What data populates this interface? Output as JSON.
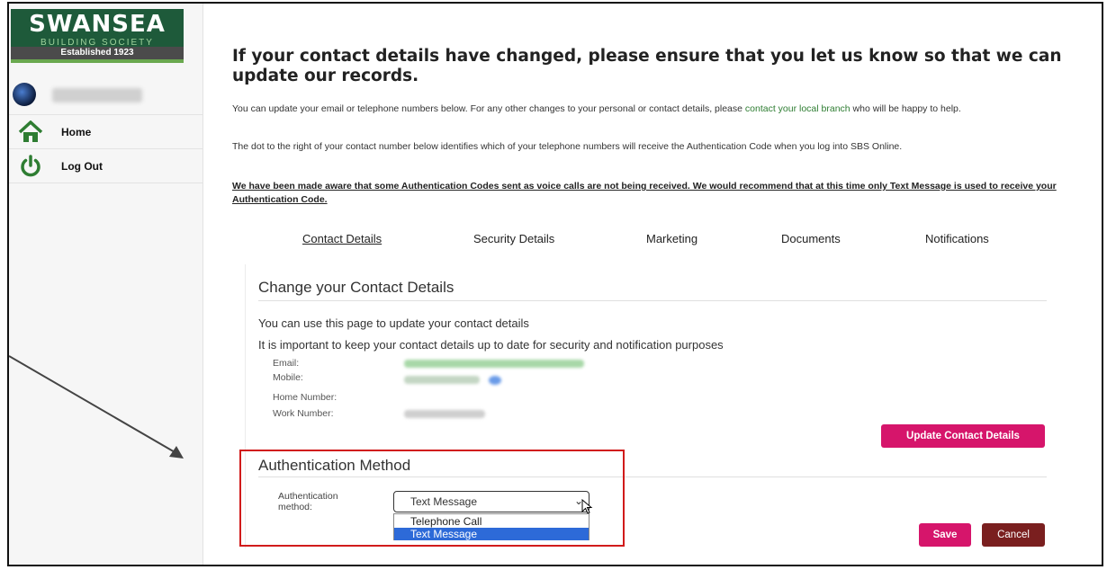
{
  "brand": {
    "name": "SWANSEA",
    "subtitle": "BUILDING SOCIETY",
    "established": "Established 1923",
    "colors": {
      "green": "#1e5a3a",
      "pink": "#d6156b",
      "maroon": "#7a1f1f"
    }
  },
  "sidebar": {
    "items": [
      {
        "label": "Home",
        "icon": "home-icon"
      },
      {
        "label": "Log Out",
        "icon": "power-icon"
      }
    ]
  },
  "main": {
    "heading": "If your contact details have changed, please ensure that you let us know so that we can update our records.",
    "intro_before_link": "You can update your email or telephone numbers below. For any other changes to your personal or contact details, please ",
    "intro_link": "contact your local branch",
    "intro_after_link": " who will be happy to help.",
    "dot_info": "The dot to the right of your contact number below identifies which of your telephone numbers will receive the Authentication Code when you log into SBS Online.",
    "warning": "We have been made aware that some Authentication Codes sent as voice calls are not being received. We would recommend that at this time only Text Message is used to receive your Authentication Code.",
    "tabs": [
      {
        "label": "Contact Details",
        "active": true
      },
      {
        "label": "Security Details"
      },
      {
        "label": "Marketing"
      },
      {
        "label": "Documents"
      },
      {
        "label": "Notifications"
      }
    ]
  },
  "contact": {
    "title": "Change your Contact Details",
    "line1": "You can use this page to update your contact details",
    "line2": "It is important to keep your contact details up to date for security and notification purposes",
    "fields": [
      {
        "label": "Email:"
      },
      {
        "label": "Mobile:"
      },
      {
        "label": "Home Number:"
      },
      {
        "label": "Work Number:"
      }
    ],
    "update_button": "Update Contact Details"
  },
  "auth": {
    "title": "Authentication Method",
    "label": "Authentication method:",
    "selected": "Text Message",
    "options": [
      "Telephone Call",
      "Text Message"
    ],
    "save": "Save",
    "cancel": "Cancel"
  }
}
